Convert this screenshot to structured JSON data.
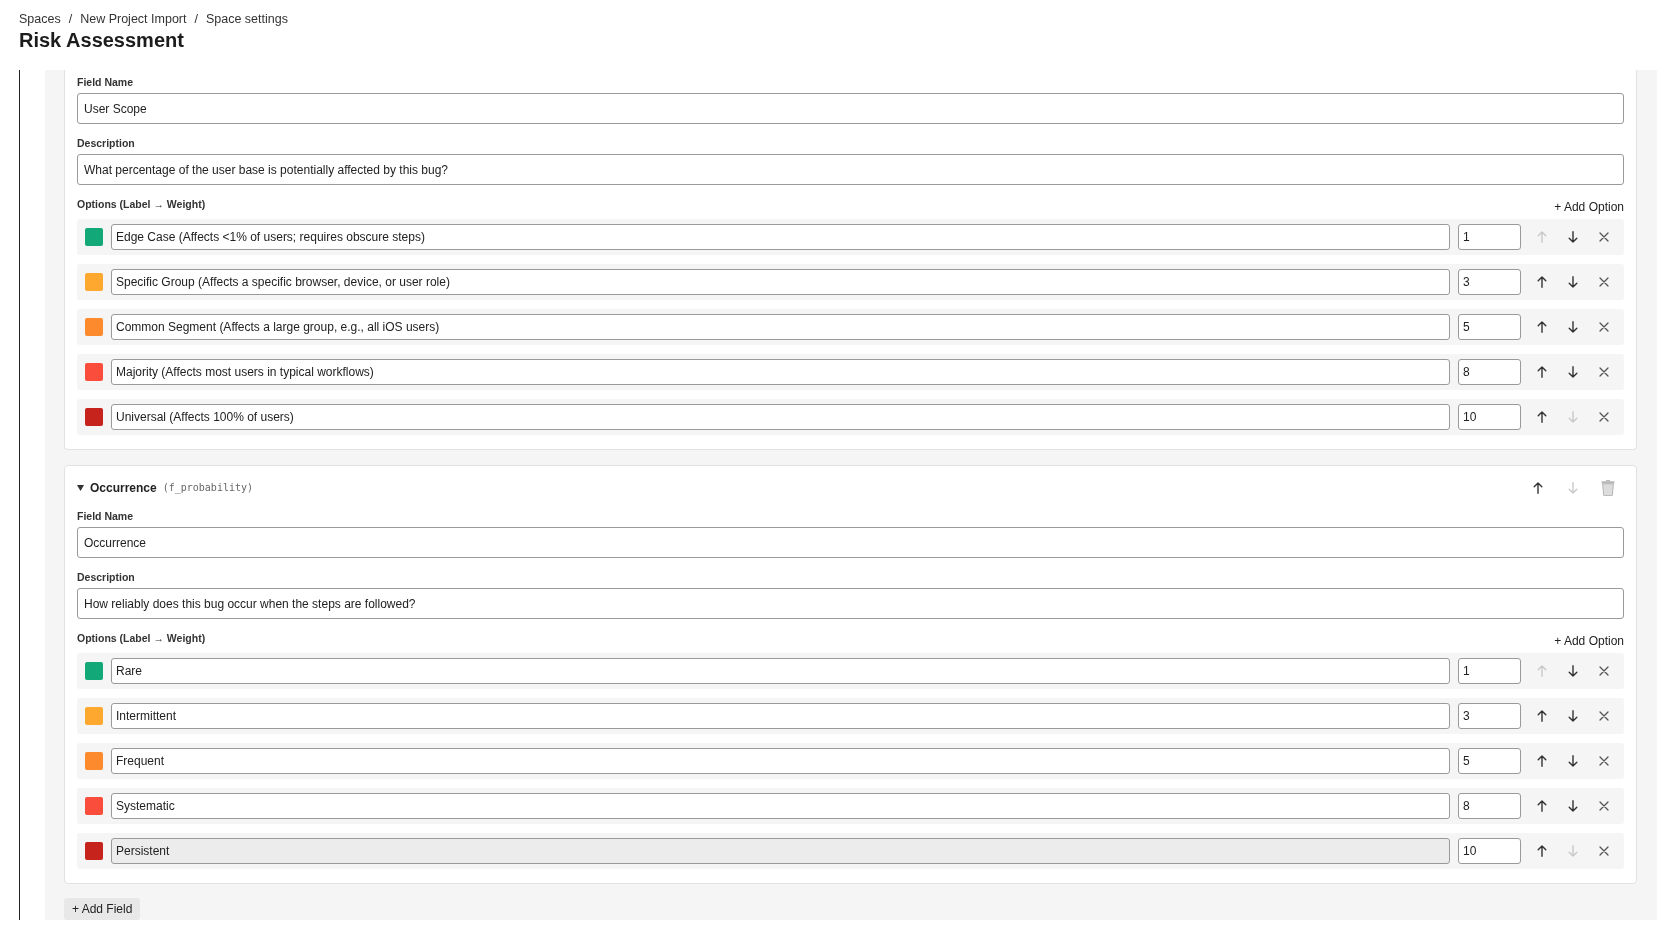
{
  "breadcrumb": {
    "items": [
      "Spaces",
      "New Project Import",
      "Space settings"
    ],
    "separator": "/"
  },
  "page_title": "Risk Assessment",
  "fields": [
    {
      "field_name_label": "Field Name",
      "field_name": "User Scope",
      "description_label": "Description",
      "description": "What percentage of the user base is potentially affected by this bug?",
      "options_label": "Options (Label → Weight)",
      "add_option": "+ Add Option",
      "options": [
        {
          "color": "#12a877",
          "label": "Edge Case (Affects <1% of users; requires obscure steps)",
          "label_disabled": false,
          "weight": "1",
          "up_disabled": true,
          "down_disabled": false
        },
        {
          "color": "#fea82f",
          "label": "Specific Group (Affects a specific browser, device, or user role)",
          "label_disabled": false,
          "weight": "3",
          "up_disabled": false,
          "down_disabled": false
        },
        {
          "color": "#fd8b2e",
          "label": "Common Segment (Affects a large group, e.g., all iOS users)",
          "label_disabled": false,
          "weight": "5",
          "up_disabled": false,
          "down_disabled": false
        },
        {
          "color": "#fa4d3b",
          "label": "Majority (Affects most users in typical workflows)",
          "label_disabled": false,
          "weight": "8",
          "up_disabled": false,
          "down_disabled": false
        },
        {
          "color": "#c5231b",
          "label": "Universal (Affects 100% of users)",
          "label_disabled": false,
          "weight": "10",
          "up_disabled": false,
          "down_disabled": true
        }
      ]
    },
    {
      "header": {
        "name": "Occurrence",
        "key": "(f_probability)",
        "expanded": true,
        "up_disabled": false,
        "down_disabled": true
      },
      "field_name_label": "Field Name",
      "field_name": "Occurrence",
      "description_label": "Description",
      "description": "How reliably does this bug occur when the steps are followed?",
      "options_label": "Options (Label → Weight)",
      "add_option": "+ Add Option",
      "options": [
        {
          "color": "#12a877",
          "label": "Rare",
          "label_disabled": false,
          "weight": "1",
          "up_disabled": true,
          "down_disabled": false
        },
        {
          "color": "#fea82f",
          "label": "Intermittent",
          "label_disabled": false,
          "weight": "3",
          "up_disabled": false,
          "down_disabled": false
        },
        {
          "color": "#fd8b2e",
          "label": "Frequent",
          "label_disabled": false,
          "weight": "5",
          "up_disabled": false,
          "down_disabled": false
        },
        {
          "color": "#fa4d3b",
          "label": "Systematic",
          "label_disabled": false,
          "weight": "8",
          "up_disabled": false,
          "down_disabled": false
        },
        {
          "color": "#c5231b",
          "label": "Persistent",
          "label_disabled": true,
          "weight": "10",
          "up_disabled": false,
          "down_disabled": true
        }
      ]
    }
  ],
  "add_field": "+ Add Field"
}
